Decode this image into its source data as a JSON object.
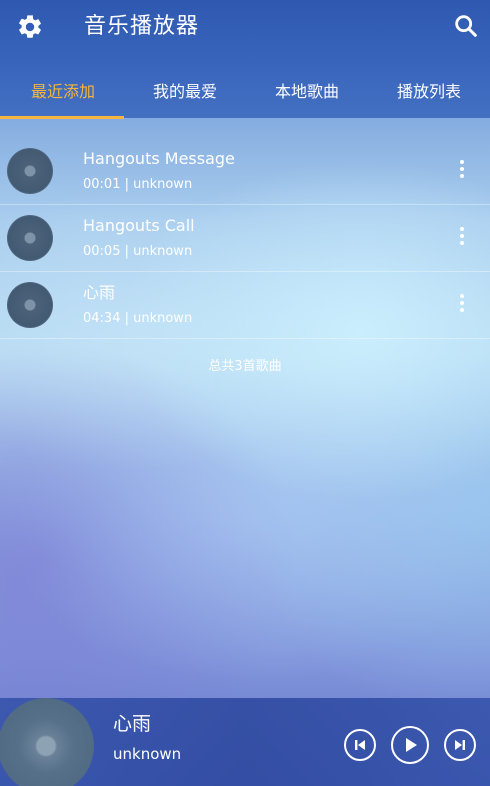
{
  "header": {
    "title": "音乐播放器",
    "settings_icon": "gear-icon",
    "search_icon": "search-icon",
    "color": "#3a66bd"
  },
  "tabs": [
    {
      "label": "最近添加",
      "active": true
    },
    {
      "label": "我的最爱",
      "active": false
    },
    {
      "label": "本地歌曲",
      "active": false
    },
    {
      "label": "播放列表",
      "active": false
    }
  ],
  "accent_color": "#f4b63c",
  "songs": [
    {
      "title": "Hangouts Message",
      "meta": "00:01 | unknown"
    },
    {
      "title": "Hangouts Call",
      "meta": "00:05 | unknown"
    },
    {
      "title": "心雨",
      "meta": "04:34 | unknown"
    }
  ],
  "total_text": "总共3首歌曲",
  "player": {
    "title": "心雨",
    "artist": "unknown",
    "controls": [
      "previous-icon",
      "play-icon",
      "next-icon"
    ]
  }
}
